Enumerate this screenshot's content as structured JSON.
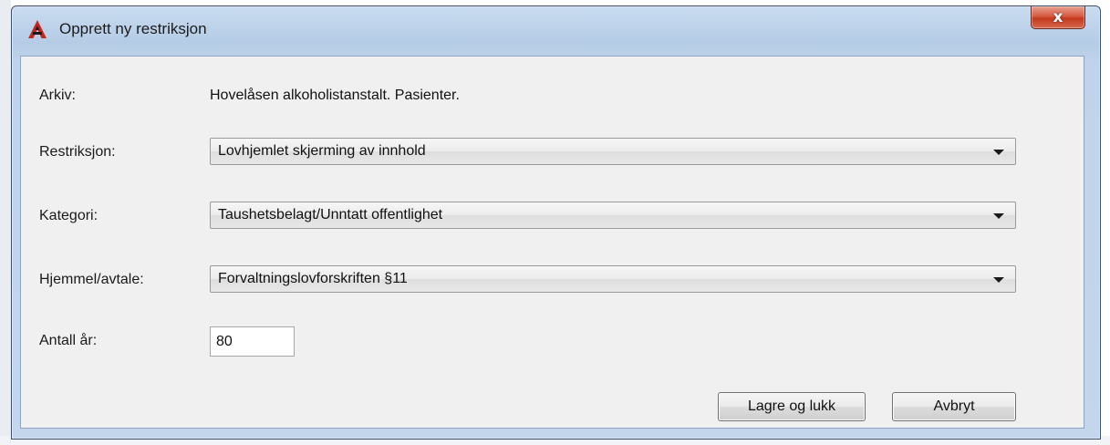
{
  "window": {
    "title": "Opprett ny restriksjon",
    "close_label": "x"
  },
  "form": {
    "arkiv_label": "Arkiv:",
    "arkiv_value": "Hovelåsen alkoholistanstalt. Pasienter.",
    "restriksjon_label": "Restriksjon:",
    "restriksjon_value": "Lovhjemlet skjerming av innhold",
    "kategori_label": "Kategori:",
    "kategori_value": "Taushetsbelagt/Unntatt offentlighet",
    "hjemmel_label": "Hjemmel/avtale:",
    "hjemmel_value": "Forvaltningslovforskriften §11",
    "antall_label": "Antall år:",
    "antall_value": "80"
  },
  "buttons": {
    "save_label": "Lagre og lukk",
    "cancel_label": "Avbryt"
  },
  "icons": {
    "app": "app-logo-icon",
    "close": "close-icon",
    "dropdown": "chevron-down-icon"
  },
  "colors": {
    "titlebar": "#bfd3ea",
    "close_button": "#c2391f",
    "client_bg": "#f0f0f0",
    "app_icon": "#c0281e"
  }
}
